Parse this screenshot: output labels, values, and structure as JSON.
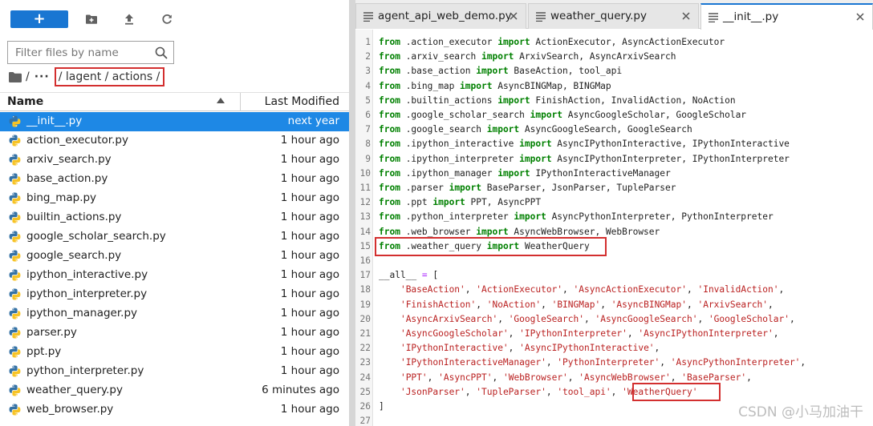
{
  "file_browser": {
    "new_button_label": "+",
    "filter_placeholder": "Filter files by name",
    "breadcrumb": {
      "root_sep": "/",
      "ellipsis": "···",
      "path": "/ lagent / actions /"
    },
    "columns": {
      "name": "Name",
      "modified": "Last Modified"
    },
    "files": [
      {
        "name": "__init__.py",
        "modified": "next year",
        "selected": true
      },
      {
        "name": "action_executor.py",
        "modified": "1 hour ago"
      },
      {
        "name": "arxiv_search.py",
        "modified": "1 hour ago"
      },
      {
        "name": "base_action.py",
        "modified": "1 hour ago"
      },
      {
        "name": "bing_map.py",
        "modified": "1 hour ago"
      },
      {
        "name": "builtin_actions.py",
        "modified": "1 hour ago"
      },
      {
        "name": "google_scholar_search.py",
        "modified": "1 hour ago"
      },
      {
        "name": "google_search.py",
        "modified": "1 hour ago"
      },
      {
        "name": "ipython_interactive.py",
        "modified": "1 hour ago"
      },
      {
        "name": "ipython_interpreter.py",
        "modified": "1 hour ago"
      },
      {
        "name": "ipython_manager.py",
        "modified": "1 hour ago"
      },
      {
        "name": "parser.py",
        "modified": "1 hour ago"
      },
      {
        "name": "ppt.py",
        "modified": "1 hour ago"
      },
      {
        "name": "python_interpreter.py",
        "modified": "1 hour ago"
      },
      {
        "name": "weather_query.py",
        "modified": "6 minutes ago"
      },
      {
        "name": "web_browser.py",
        "modified": "1 hour ago"
      }
    ]
  },
  "tabs": [
    {
      "label": "agent_api_web_demo.py",
      "active": false
    },
    {
      "label": "weather_query.py",
      "active": false
    },
    {
      "label": "__init__.py",
      "active": true
    }
  ],
  "code_lines": [
    [
      [
        "kw",
        "from"
      ],
      [
        "t",
        " .action_executor "
      ],
      [
        "kw",
        "import"
      ],
      [
        "t",
        " ActionExecutor, AsyncActionExecutor"
      ]
    ],
    [
      [
        "kw",
        "from"
      ],
      [
        "t",
        " .arxiv_search "
      ],
      [
        "kw",
        "import"
      ],
      [
        "t",
        " ArxivSearch, AsyncArxivSearch"
      ]
    ],
    [
      [
        "kw",
        "from"
      ],
      [
        "t",
        " .base_action "
      ],
      [
        "kw",
        "import"
      ],
      [
        "t",
        " BaseAction, tool_api"
      ]
    ],
    [
      [
        "kw",
        "from"
      ],
      [
        "t",
        " .bing_map "
      ],
      [
        "kw",
        "import"
      ],
      [
        "t",
        " AsyncBINGMap, BINGMap"
      ]
    ],
    [
      [
        "kw",
        "from"
      ],
      [
        "t",
        " .builtin_actions "
      ],
      [
        "kw",
        "import"
      ],
      [
        "t",
        " FinishAction, InvalidAction, NoAction"
      ]
    ],
    [
      [
        "kw",
        "from"
      ],
      [
        "t",
        " .google_scholar_search "
      ],
      [
        "kw",
        "import"
      ],
      [
        "t",
        " AsyncGoogleScholar, GoogleScholar"
      ]
    ],
    [
      [
        "kw",
        "from"
      ],
      [
        "t",
        " .google_search "
      ],
      [
        "kw",
        "import"
      ],
      [
        "t",
        " AsyncGoogleSearch, GoogleSearch"
      ]
    ],
    [
      [
        "kw",
        "from"
      ],
      [
        "t",
        " .ipython_interactive "
      ],
      [
        "kw",
        "import"
      ],
      [
        "t",
        " AsyncIPythonInteractive, IPythonInteractive"
      ]
    ],
    [
      [
        "kw",
        "from"
      ],
      [
        "t",
        " .ipython_interpreter "
      ],
      [
        "kw",
        "import"
      ],
      [
        "t",
        " AsyncIPythonInterpreter, IPythonInterpreter"
      ]
    ],
    [
      [
        "kw",
        "from"
      ],
      [
        "t",
        " .ipython_manager "
      ],
      [
        "kw",
        "import"
      ],
      [
        "t",
        " IPythonInteractiveManager"
      ]
    ],
    [
      [
        "kw",
        "from"
      ],
      [
        "t",
        " .parser "
      ],
      [
        "kw",
        "import"
      ],
      [
        "t",
        " BaseParser, JsonParser, TupleParser"
      ]
    ],
    [
      [
        "kw",
        "from"
      ],
      [
        "t",
        " .ppt "
      ],
      [
        "kw",
        "import"
      ],
      [
        "t",
        " PPT, AsyncPPT"
      ]
    ],
    [
      [
        "kw",
        "from"
      ],
      [
        "t",
        " .python_interpreter "
      ],
      [
        "kw",
        "import"
      ],
      [
        "t",
        " AsyncPythonInterpreter, PythonInterpreter"
      ]
    ],
    [
      [
        "kw",
        "from"
      ],
      [
        "t",
        " .web_browser "
      ],
      [
        "kw",
        "import"
      ],
      [
        "t",
        " AsyncWebBrowser, WebBrowser"
      ]
    ],
    [
      [
        "kw",
        "from"
      ],
      [
        "t",
        " .weather_query "
      ],
      [
        "kw",
        "import"
      ],
      [
        "t",
        " WeatherQuery"
      ]
    ],
    [],
    [
      [
        "t",
        "__all__ "
      ],
      [
        "op",
        "="
      ],
      [
        "t",
        " ["
      ]
    ],
    [
      [
        "t",
        "    "
      ],
      [
        "str",
        "'BaseAction'"
      ],
      [
        "t",
        ", "
      ],
      [
        "str",
        "'ActionExecutor'"
      ],
      [
        "t",
        ", "
      ],
      [
        "str",
        "'AsyncActionExecutor'"
      ],
      [
        "t",
        ", "
      ],
      [
        "str",
        "'InvalidAction'"
      ],
      [
        "t",
        ","
      ]
    ],
    [
      [
        "t",
        "    "
      ],
      [
        "str",
        "'FinishAction'"
      ],
      [
        "t",
        ", "
      ],
      [
        "str",
        "'NoAction'"
      ],
      [
        "t",
        ", "
      ],
      [
        "str",
        "'BINGMap'"
      ],
      [
        "t",
        ", "
      ],
      [
        "str",
        "'AsyncBINGMap'"
      ],
      [
        "t",
        ", "
      ],
      [
        "str",
        "'ArxivSearch'"
      ],
      [
        "t",
        ","
      ]
    ],
    [
      [
        "t",
        "    "
      ],
      [
        "str",
        "'AsyncArxivSearch'"
      ],
      [
        "t",
        ", "
      ],
      [
        "str",
        "'GoogleSearch'"
      ],
      [
        "t",
        ", "
      ],
      [
        "str",
        "'AsyncGoogleSearch'"
      ],
      [
        "t",
        ", "
      ],
      [
        "str",
        "'GoogleScholar'"
      ],
      [
        "t",
        ","
      ]
    ],
    [
      [
        "t",
        "    "
      ],
      [
        "str",
        "'AsyncGoogleScholar'"
      ],
      [
        "t",
        ", "
      ],
      [
        "str",
        "'IPythonInterpreter'"
      ],
      [
        "t",
        ", "
      ],
      [
        "str",
        "'AsyncIPythonInterpreter'"
      ],
      [
        "t",
        ","
      ]
    ],
    [
      [
        "t",
        "    "
      ],
      [
        "str",
        "'IPythonInteractive'"
      ],
      [
        "t",
        ", "
      ],
      [
        "str",
        "'AsyncIPythonInteractive'"
      ],
      [
        "t",
        ","
      ]
    ],
    [
      [
        "t",
        "    "
      ],
      [
        "str",
        "'IPythonInteractiveManager'"
      ],
      [
        "t",
        ", "
      ],
      [
        "str",
        "'PythonInterpreter'"
      ],
      [
        "t",
        ", "
      ],
      [
        "str",
        "'AsyncPythonInterpreter'"
      ],
      [
        "t",
        ","
      ]
    ],
    [
      [
        "t",
        "    "
      ],
      [
        "str",
        "'PPT'"
      ],
      [
        "t",
        ", "
      ],
      [
        "str",
        "'AsyncPPT'"
      ],
      [
        "t",
        ", "
      ],
      [
        "str",
        "'WebBrowser'"
      ],
      [
        "t",
        ", "
      ],
      [
        "str",
        "'AsyncWebBrowser'"
      ],
      [
        "t",
        ", "
      ],
      [
        "str",
        "'BaseParser'"
      ],
      [
        "t",
        ","
      ]
    ],
    [
      [
        "t",
        "    "
      ],
      [
        "str",
        "'JsonParser'"
      ],
      [
        "t",
        ", "
      ],
      [
        "str",
        "'TupleParser'"
      ],
      [
        "t",
        ", "
      ],
      [
        "str",
        "'tool_api'"
      ],
      [
        "t",
        ", "
      ],
      [
        "str",
        "'WeatherQuery'"
      ]
    ],
    [
      [
        "t",
        "]"
      ]
    ],
    []
  ],
  "watermark": "CSDN @小马加油干",
  "colors": {
    "accent": "#1976d2",
    "selected_row": "#1e88e5",
    "highlight_box": "#d32f2f",
    "keyword": "#008000",
    "string": "#ba2121",
    "operator": "#aa22ff",
    "python_icon_blue": "#3572a5",
    "python_icon_yellow": "#f7c325"
  },
  "icons": {
    "toolbar": [
      "new-folder-icon",
      "upload-icon",
      "refresh-icon"
    ],
    "filter": "search-icon",
    "file": "python-file-icon",
    "tab": "text-file-icon",
    "tab_close": "close-icon"
  }
}
